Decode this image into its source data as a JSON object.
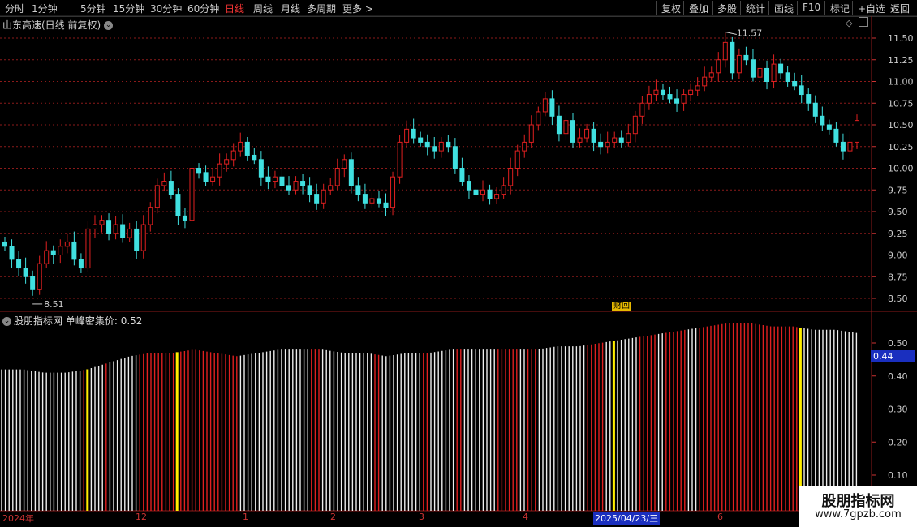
{
  "toolbar": {
    "tabs": [
      "分时",
      "1分钟",
      "5分钟",
      "15分钟",
      "30分钟",
      "60分钟",
      "日线",
      "周线",
      "月线",
      "多周期",
      "更多 >"
    ],
    "active_tab": "日线",
    "buttons": [
      "复权",
      "叠加",
      "多股",
      "统计",
      "画线",
      "F10",
      "标记",
      "+自选",
      "返回"
    ]
  },
  "chart": {
    "title": "山东高速(日线 前复权)",
    "price_axis": [
      "11.50",
      "11.25",
      "11.00",
      "10.75",
      "10.50",
      "10.25",
      "10.00",
      "9.75",
      "9.50",
      "9.25",
      "9.00",
      "8.75",
      "8.50"
    ],
    "high_label": "11.57",
    "low_label": "8.51",
    "finance_badge": "财回"
  },
  "indicator": {
    "name": "股朋指标网",
    "line_label": "单峰密集价: 0.52",
    "axis": [
      "0.50",
      "0.40",
      "0.30",
      "0.20",
      "0.10"
    ],
    "current_tag": "0.44"
  },
  "time_axis": {
    "labels": [
      "2024年",
      "12",
      "1",
      "2",
      "3",
      "4",
      "2025/04/23/三",
      "6"
    ]
  },
  "watermark": {
    "name": "股朋指标网",
    "url": "www.7gpzb.com"
  },
  "colors": {
    "up": "#e02020",
    "down": "#40e0e0",
    "grid": "#8b1a1a",
    "highlight": "#ffee00",
    "tag_blue": "#1a2fbf"
  },
  "chart_data": {
    "type": "candlestick+bar",
    "series": [
      {
        "name": "山东高速",
        "note": "daily closes approx",
        "values": [
          9.1,
          8.95,
          8.85,
          8.75,
          8.6,
          8.9,
          9.05,
          9.0,
          9.1,
          9.15,
          8.95,
          8.85,
          9.3,
          9.35,
          9.4,
          9.25,
          9.35,
          9.2,
          9.3,
          9.05,
          9.35,
          9.55,
          9.8,
          9.85,
          9.7,
          9.45,
          9.4,
          10.0,
          9.95,
          9.85,
          9.9,
          10.05,
          10.1,
          10.2,
          10.3,
          10.15,
          10.1,
          9.9,
          9.85,
          9.9,
          9.8,
          9.75,
          9.85,
          9.8,
          9.7,
          9.6,
          9.75,
          9.8,
          10.0,
          10.1,
          9.8,
          9.7,
          9.6,
          9.65,
          9.6,
          9.55,
          9.9,
          10.3,
          10.45,
          10.35,
          10.3,
          10.25,
          10.2,
          10.3,
          10.25,
          10.0,
          9.85,
          9.75,
          9.7,
          9.75,
          9.65,
          9.7,
          9.8,
          10.0,
          10.2,
          10.3,
          10.5,
          10.65,
          10.8,
          10.6,
          10.4,
          10.55,
          10.3,
          10.35,
          10.45,
          10.3,
          10.25,
          10.3,
          10.35,
          10.3,
          10.4,
          10.6,
          10.75,
          10.85,
          10.9,
          10.85,
          10.8,
          10.75,
          10.85,
          10.9,
          10.95,
          11.05,
          11.1,
          11.25,
          11.45,
          11.1,
          11.3,
          11.25,
          11.05,
          11.15,
          11.0,
          11.2,
          11.1,
          11.0,
          10.95,
          10.85,
          10.75,
          10.6,
          10.5,
          10.45,
          10.3,
          10.2,
          10.3,
          10.55
        ]
      },
      {
        "name": "单峰密集价",
        "values": [
          0.42,
          0.42,
          0.41,
          0.41,
          0.42,
          0.44,
          0.46,
          0.47,
          0.47,
          0.48,
          0.47,
          0.46,
          0.47,
          0.48,
          0.48,
          0.48,
          0.47,
          0.47,
          0.46,
          0.47,
          0.47,
          0.48,
          0.48,
          0.48,
          0.48,
          0.48,
          0.49,
          0.49,
          0.5,
          0.51,
          0.52,
          0.53,
          0.54,
          0.55,
          0.56,
          0.56,
          0.55,
          0.55,
          0.54,
          0.54,
          0.53
        ]
      }
    ]
  }
}
